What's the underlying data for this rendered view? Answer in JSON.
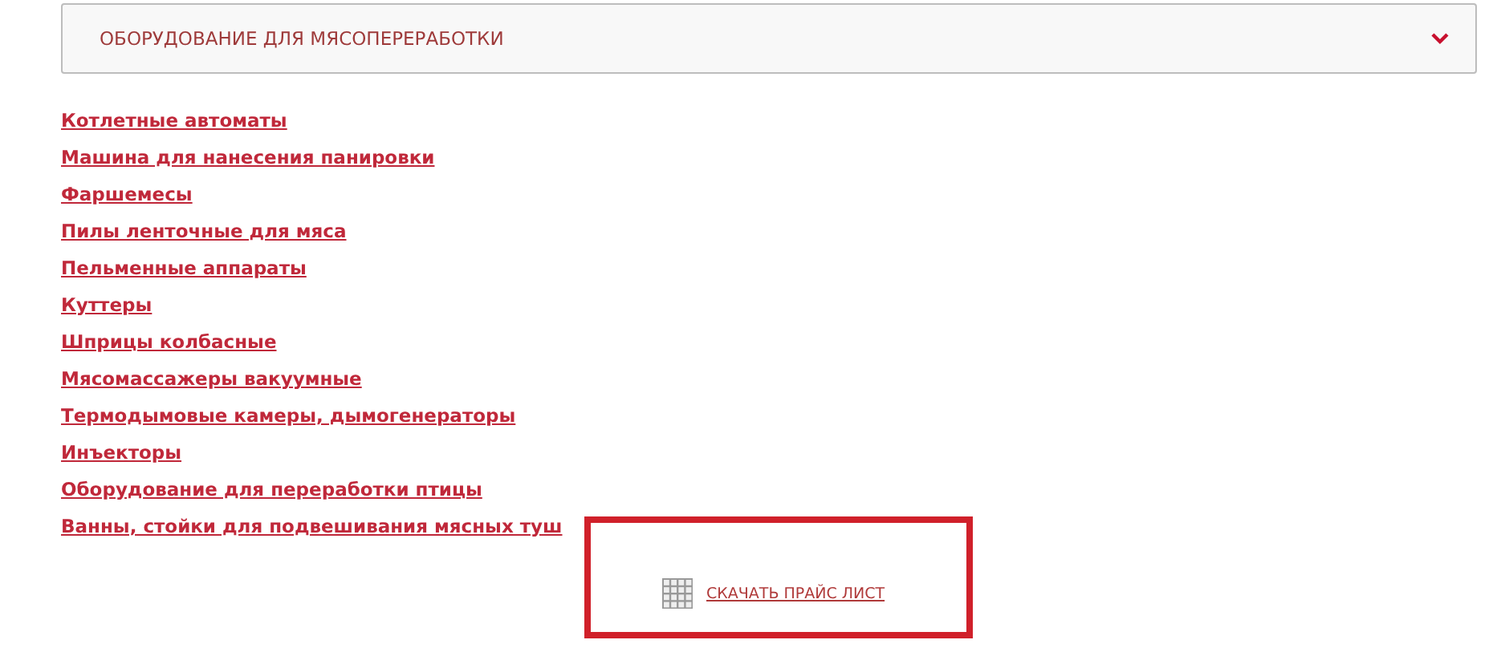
{
  "accordion": {
    "title": "ОБОРУДОВАНИЕ ДЛЯ МЯСОПЕРЕРАБОТКИ",
    "expanded": false
  },
  "links": [
    "Котлетные автоматы",
    "Машина для нанесения панировки",
    "Фаршемесы",
    "Пилы ленточные для мяса",
    "Пельменные аппараты",
    "Куттеры",
    "Шприцы колбасные",
    "Мясомассажеры вакуумные",
    "Термодымовые камеры, дымогенераторы",
    "Инъекторы",
    "Оборудование для переработки птицы",
    "Ванны, стойки для подвешивания мясных туш"
  ],
  "download": {
    "label": "СКАЧАТЬ ПРАЙС ЛИСТ"
  }
}
